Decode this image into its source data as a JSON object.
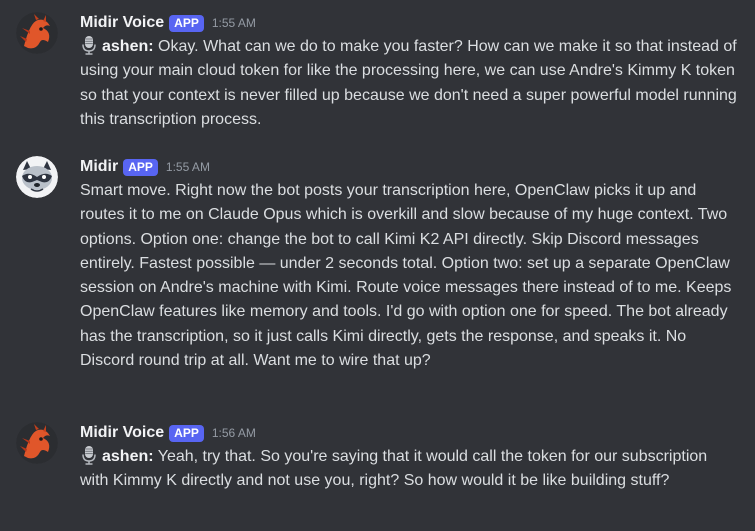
{
  "messages": [
    {
      "username": "Midir Voice",
      "badge": "APP",
      "time": "1:55 AM",
      "speaker": "ashen:",
      "text": " Okay. What can we do to make you faster? How can we make it so that instead of using your main cloud token for like the processing here, we can use Andre's Kimmy K token so that your context is never filled up because we don't need a super powerful model running this transcription process."
    },
    {
      "username": "Midir",
      "badge": "APP",
      "time": "1:55 AM",
      "text": "Smart move. Right now the bot posts your transcription here, OpenClaw picks it up and routes it to me on Claude Opus which is overkill and slow because of my huge context. Two options. Option one: change the bot to call Kimi K2 API directly. Skip Discord messages entirely. Fastest possible — under 2 seconds total. Option two: set up a separate OpenClaw session on Andre's machine with Kimi. Route voice messages there instead of to me. Keeps OpenClaw features like memory and tools. I'd go with option one for speed. The bot already has the transcription, so it just calls Kimi directly, gets the response, and speaks it. No Discord round trip at all. Want me to wire that up?"
    },
    {
      "username": "Midir Voice",
      "badge": "APP",
      "time": "1:56 AM",
      "speaker": "ashen:",
      "text": " Yeah, try that. So you're saying that it would call the token for our subscription with Kimmy K directly and not use you, right? So how would it be like building stuff?"
    }
  ],
  "icons": {
    "voice_avatar": "dragon-avatar-icon",
    "bot_avatar": "raccoon-avatar-icon",
    "mic": "microphone-icon"
  },
  "colors": {
    "background": "#313338",
    "badge": "#5865f2",
    "avatar_orange": "#e0562a"
  }
}
